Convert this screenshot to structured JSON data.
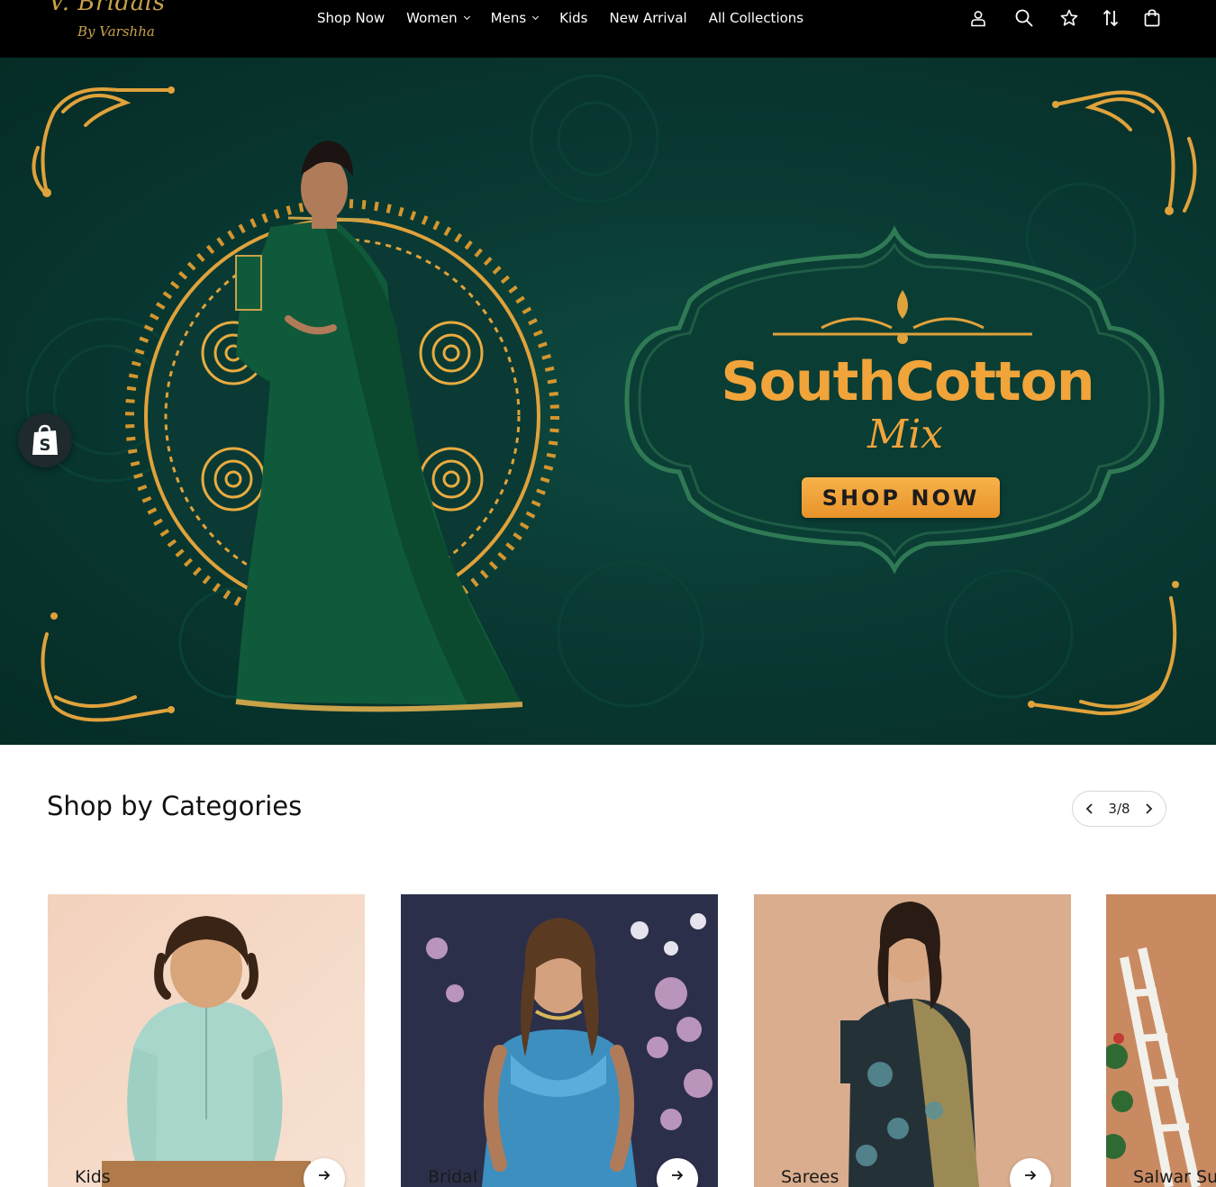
{
  "header": {
    "logo": {
      "line1": "V. Bridals",
      "line2": "By Varshha"
    },
    "nav": [
      {
        "label": "Shop Now",
        "has_dropdown": false
      },
      {
        "label": "Women",
        "has_dropdown": true
      },
      {
        "label": "Mens",
        "has_dropdown": true
      },
      {
        "label": "Kids",
        "has_dropdown": false
      },
      {
        "label": "New Arrival",
        "has_dropdown": false
      },
      {
        "label": "All Collections",
        "has_dropdown": false
      }
    ],
    "icons": [
      "account-icon",
      "search-icon",
      "wishlist-star-icon",
      "sort-icon",
      "cart-bag-icon"
    ]
  },
  "hero": {
    "title": "SouthCotton",
    "subtitle": "Mix",
    "cta_label": "SHOP NOW",
    "colors": {
      "background": "#093a33",
      "gold": "#f0a43a",
      "cta": "#f0a03a"
    }
  },
  "shopify_widget": {
    "icon": "shopify-bag-icon"
  },
  "categories": {
    "title": "Shop by Categories",
    "pager": "3/8",
    "items": [
      {
        "label": "Kids"
      },
      {
        "label": "Bridal"
      },
      {
        "label": "Sarees"
      },
      {
        "label": "Salwar Su"
      }
    ]
  }
}
